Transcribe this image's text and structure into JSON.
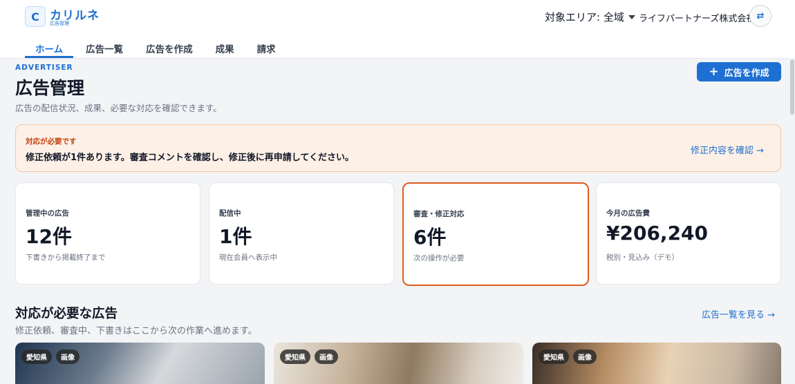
{
  "app": {
    "logo_letter": "C",
    "name": "カリルネ",
    "subtitle": "広告管理"
  },
  "header": {
    "area_label": "対象エリア: 全域",
    "company": "ライフパートナーズ株式会社"
  },
  "nav": {
    "tabs": [
      {
        "label": "ホーム",
        "active": true
      },
      {
        "label": "広告一覧",
        "active": false
      },
      {
        "label": "広告を作成",
        "active": false
      },
      {
        "label": "成果",
        "active": false
      },
      {
        "label": "請求",
        "active": false
      }
    ]
  },
  "page": {
    "eyebrow": "ADVERTISER",
    "title": "広告管理",
    "subtitle": "広告の配信状況、成果、必要な対応を確認できます。",
    "create_button": "広告を作成"
  },
  "alert": {
    "label": "対応が必要です",
    "message": "修正依頼が1件あります。審査コメントを確認し、修正後に再申請してください。",
    "link": "修正内容を確認 →"
  },
  "stats": [
    {
      "label": "管理中の広告",
      "value": "12件",
      "note": "下書きから掲載終了まで"
    },
    {
      "label": "配信中",
      "value": "1件",
      "note": "現在会員へ表示中"
    },
    {
      "label": "審査・修正対応",
      "value": "6件",
      "note": "次の操作が必要"
    },
    {
      "label": "今月の広告費",
      "value": "¥206,240",
      "note": "税別・見込み（デモ）"
    }
  ],
  "section": {
    "title": "対応が必要な広告",
    "subtitle": "修正依頼、審査中、下書きはここから次の作業へ進めます。",
    "link": "広告一覧を見る →"
  },
  "ad_cards": [
    {
      "tags": [
        "愛知県",
        "画像"
      ]
    },
    {
      "tags": [
        "愛知県",
        "画像"
      ]
    },
    {
      "tags": [
        "愛知県",
        "画像"
      ]
    }
  ],
  "colors": {
    "accent": "#1d6fd1",
    "alert_bg": "#fdf0e6",
    "alert_label": "#c2410c",
    "highlight_border": "#e05b1e"
  }
}
